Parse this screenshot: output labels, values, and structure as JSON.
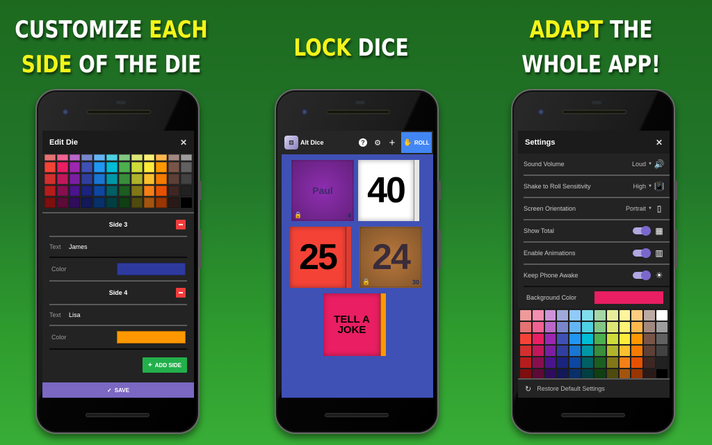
{
  "headlines": [
    {
      "line1_white": "CUSTOMIZE ",
      "line1_yellow": "EACH",
      "line2_yellow": "SIDE",
      "line2_white": " OF THE DIE"
    },
    {
      "yellow": "LOCK",
      "white": " DICE"
    },
    {
      "line1_yellow": "ADAPT",
      "line1_white": " THE",
      "line2_white": "WHOLE APP!"
    }
  ],
  "colors": {
    "background_green": "#22772a",
    "highlight_yellow": "#f4f41a",
    "accent_purple": "#7a68c3",
    "roll_blue": "#4286f4",
    "add_green": "#22b04b",
    "remove_red": "#f23c3c",
    "dice_area_blue": "#3f51b5"
  },
  "edit_die": {
    "title": "Edit Die",
    "close_icon": "close-icon",
    "palette": [
      [
        "#e57373",
        "#f06292",
        "#ba68c8",
        "#7986cb",
        "#64b5f6",
        "#4dd0e1",
        "#81c784",
        "#dce775",
        "#fff176",
        "#ffb74d",
        "#a1887f",
        "#9e9e9e"
      ],
      [
        "#f44336",
        "#e91e63",
        "#9c27b0",
        "#3f51b5",
        "#2196f3",
        "#00bcd4",
        "#4caf50",
        "#cddc39",
        "#ffeb3b",
        "#ff9800",
        "#795548",
        "#616161"
      ],
      [
        "#d32f2f",
        "#c2185b",
        "#7b1fa2",
        "#303f9f",
        "#1976d2",
        "#0097a7",
        "#388e3c",
        "#afb42b",
        "#fbc02d",
        "#f57c00",
        "#5d4037",
        "#424242"
      ],
      [
        "#b71c1c",
        "#880e4f",
        "#4a148c",
        "#1a237e",
        "#0d47a1",
        "#006064",
        "#1b5e20",
        "#827717",
        "#f57f17",
        "#e65100",
        "#3e2723",
        "#212121"
      ],
      [
        "#7f0e0e",
        "#5e0a36",
        "#2f0d5c",
        "#121858",
        "#08306b",
        "#003f41",
        "#103f13",
        "#4f4a0e",
        "#a3540f",
        "#993500",
        "#2a1a17",
        "#000000"
      ]
    ],
    "sides": [
      {
        "title": "Side 3",
        "text_label": "Text",
        "text_value": "James",
        "color_label": "Color",
        "color": "#2e3a9e"
      },
      {
        "title": "Side 4",
        "text_label": "Text",
        "text_value": "Lisa",
        "color_label": "Color",
        "color": "#ff9800"
      }
    ],
    "add_side_label": "ADD SIDE",
    "save_label": "SAVE"
  },
  "alt_dice": {
    "app_title": "Alt Dice",
    "roll_label": "ROLL",
    "toolbar_icons": [
      "help-icon",
      "gear-icon",
      "plus-icon",
      "hand-roll-icon"
    ],
    "dice": [
      {
        "face": "Paul",
        "color": "#8e2eb0",
        "locked": true,
        "sides": "4",
        "text_color": "#3a2c6a"
      },
      {
        "face": "40",
        "color": "#ffffff",
        "locked": false,
        "sides": "",
        "text_color": "#000000"
      },
      {
        "face": "25",
        "color": "#f44336",
        "locked": false,
        "sides": "",
        "text_color": "#000000"
      },
      {
        "face": "24",
        "color": "#b8783c",
        "locked": true,
        "sides": "30",
        "text_color": "#3a2c3a"
      },
      {
        "face": "TELL A JOKE",
        "color": "#e91e63",
        "locked": false,
        "sides": "",
        "text_color": "#000000"
      }
    ]
  },
  "settings": {
    "title": "Settings",
    "rows": [
      {
        "label": "Sound Volume",
        "value": "Loud",
        "icon": "speaker-icon",
        "type": "dropdown"
      },
      {
        "label": "Shake to Roll Sensitivity",
        "value": "High",
        "icon": "shake-phone-icon",
        "type": "dropdown"
      },
      {
        "label": "Screen Orientation",
        "value": "Portrait",
        "icon": "phone-portrait-icon",
        "type": "dropdown"
      },
      {
        "label": "Show Total",
        "value": true,
        "icon": "calculator-icon",
        "type": "toggle"
      },
      {
        "label": "Enable Animations",
        "value": true,
        "icon": "film-icon",
        "type": "toggle"
      },
      {
        "label": "Keep Phone Awake",
        "value": true,
        "icon": "sun-icon",
        "type": "toggle"
      }
    ],
    "background_color_label": "Background Color",
    "background_color": "#e91e63",
    "palette": [
      [
        "#ef9a9a",
        "#f48fb1",
        "#ce93d8",
        "#9fa8da",
        "#90caf9",
        "#80deea",
        "#a5d6a7",
        "#e6ee9c",
        "#fff59d",
        "#ffcc80",
        "#bcaaa4",
        "#ffffff"
      ],
      [
        "#e57373",
        "#f06292",
        "#ba68c8",
        "#7986cb",
        "#64b5f6",
        "#4dd0e1",
        "#81c784",
        "#dce775",
        "#fff176",
        "#ffb74d",
        "#a1887f",
        "#9e9e9e"
      ],
      [
        "#f44336",
        "#e91e63",
        "#9c27b0",
        "#3f51b5",
        "#2196f3",
        "#00bcd4",
        "#4caf50",
        "#cddc39",
        "#ffeb3b",
        "#ff9800",
        "#795548",
        "#616161"
      ],
      [
        "#d32f2f",
        "#c2185b",
        "#7b1fa2",
        "#303f9f",
        "#1976d2",
        "#0097a7",
        "#388e3c",
        "#afb42b",
        "#fbc02d",
        "#f57c00",
        "#5d4037",
        "#424242"
      ],
      [
        "#b71c1c",
        "#880e4f",
        "#4a148c",
        "#1a237e",
        "#0d47a1",
        "#006064",
        "#1b5e20",
        "#827717",
        "#f57f17",
        "#e65100",
        "#3e2723",
        "#212121"
      ],
      [
        "#7f0e0e",
        "#5e0a36",
        "#2f0d5c",
        "#121858",
        "#08306b",
        "#003f41",
        "#103f13",
        "#4f4a0e",
        "#a3540f",
        "#993500",
        "#2a1a17",
        "#000000"
      ]
    ],
    "restore_label": "Restore Default Settings"
  }
}
